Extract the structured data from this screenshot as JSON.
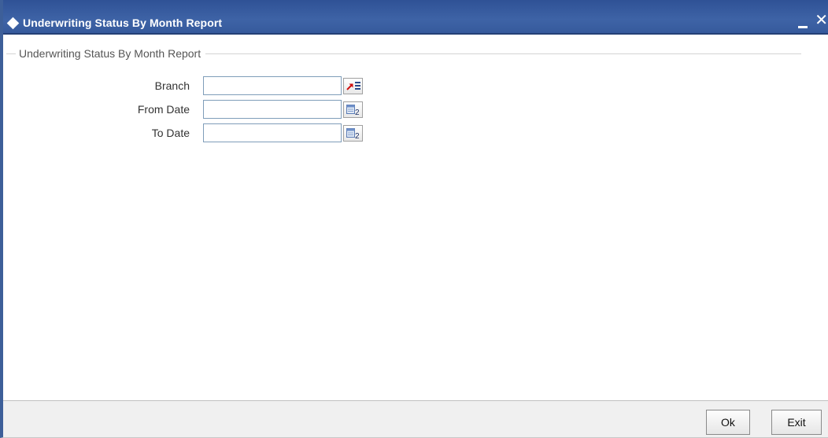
{
  "window": {
    "title": "Underwriting Status By Month Report",
    "minimize_icon": "minimize-icon",
    "close_label": "✕",
    "colors": {
      "titlebar": "#3a5fa3",
      "border": "#3d5f99"
    }
  },
  "form": {
    "section_title": "Underwriting Status By Month Report",
    "fields": [
      {
        "label": "Branch",
        "value": "",
        "button_icon": "lov-icon"
      },
      {
        "label": "From Date",
        "value": "",
        "button_icon": "calendar-icon"
      },
      {
        "label": "To Date",
        "value": "",
        "button_icon": "calendar-icon"
      }
    ]
  },
  "footer": {
    "ok_label": "Ok",
    "exit_label": "Exit"
  }
}
